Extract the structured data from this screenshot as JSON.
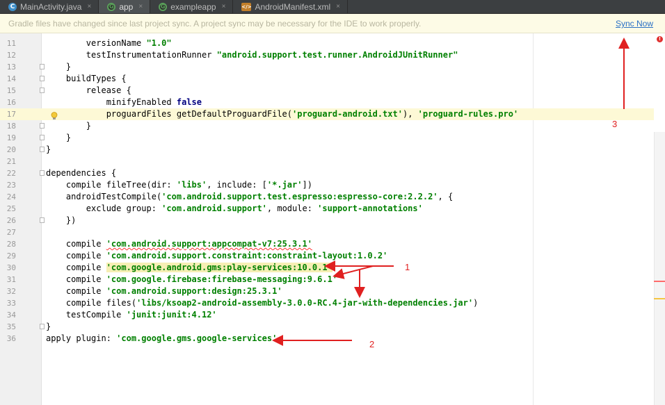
{
  "tabs": [
    {
      "label": "MainActivity.java",
      "icon": "c"
    },
    {
      "label": "app",
      "icon": "gradle"
    },
    {
      "label": "exampleapp",
      "icon": "gradle"
    },
    {
      "label": "AndroidManifest.xml",
      "icon": "xml"
    }
  ],
  "notification": {
    "message": "Gradle files have changed since last project sync. A project sync may be necessary for the IDE to work properly.",
    "action": "Sync Now"
  },
  "lines": [
    {
      "n": "11",
      "code": [
        {
          "t": "        versionName "
        },
        {
          "t": "\"1.0\"",
          "c": "str"
        }
      ]
    },
    {
      "n": "12",
      "code": [
        {
          "t": "        testInstrumentationRunner "
        },
        {
          "t": "\"android.support.test.runner.AndroidJUnitRunner\"",
          "c": "str"
        }
      ]
    },
    {
      "n": "13",
      "code": [
        {
          "t": "    }"
        }
      ]
    },
    {
      "n": "14",
      "code": [
        {
          "t": "    buildTypes {"
        }
      ]
    },
    {
      "n": "15",
      "code": [
        {
          "t": "        release {"
        }
      ]
    },
    {
      "n": "16",
      "code": [
        {
          "t": "            minifyEnabled "
        },
        {
          "t": "false",
          "c": "kw"
        }
      ]
    },
    {
      "n": "17",
      "code": [
        {
          "t": "            proguardFiles getDefaultProguardFile("
        },
        {
          "t": "'proguard-android.txt'",
          "c": "str"
        },
        {
          "t": "), "
        },
        {
          "t": "'proguard-rules.pro'",
          "c": "str"
        }
      ]
    },
    {
      "n": "18",
      "code": [
        {
          "t": "        }"
        }
      ]
    },
    {
      "n": "19",
      "code": [
        {
          "t": "    }"
        }
      ]
    },
    {
      "n": "20",
      "code": [
        {
          "t": "}"
        }
      ]
    },
    {
      "n": "21",
      "code": []
    },
    {
      "n": "22",
      "code": [
        {
          "t": "dependencies {"
        }
      ]
    },
    {
      "n": "23",
      "code": [
        {
          "t": "    compile fileTree(dir: "
        },
        {
          "t": "'libs'",
          "c": "str"
        },
        {
          "t": ", include: ["
        },
        {
          "t": "'*.jar'",
          "c": "str"
        },
        {
          "t": "])"
        }
      ]
    },
    {
      "n": "24",
      "code": [
        {
          "t": "    androidTestCompile("
        },
        {
          "t": "'com.android.support.test.espresso:espresso-core:2.2.2'",
          "c": "str"
        },
        {
          "t": ", {"
        }
      ]
    },
    {
      "n": "25",
      "code": [
        {
          "t": "        exclude group: "
        },
        {
          "t": "'com.android.support'",
          "c": "str"
        },
        {
          "t": ", module: "
        },
        {
          "t": "'support-annotations'",
          "c": "str"
        }
      ]
    },
    {
      "n": "26",
      "code": [
        {
          "t": "    })"
        }
      ]
    },
    {
      "n": "27",
      "code": []
    },
    {
      "n": "28",
      "code": [
        {
          "t": "    compile "
        },
        {
          "t": "'com.android.support:appcompat-v7:25.3.1'",
          "c": "str squig"
        }
      ]
    },
    {
      "n": "29",
      "code": [
        {
          "t": "    compile "
        },
        {
          "t": "'com.android.support.constraint:constraint-layout:1.0.2'",
          "c": "str"
        }
      ]
    },
    {
      "n": "30",
      "code": [
        {
          "t": "    compile "
        },
        {
          "t": "'com.google.android.gms:play-services:10.0.1'",
          "c": "str hlbg"
        }
      ]
    },
    {
      "n": "31",
      "code": [
        {
          "t": "    compile "
        },
        {
          "t": "'com.google.firebase:firebase-messaging:9.6.1'",
          "c": "str"
        }
      ]
    },
    {
      "n": "32",
      "code": [
        {
          "t": "    compile "
        },
        {
          "t": "'com.android.support:design:25.3.1'",
          "c": "str"
        }
      ]
    },
    {
      "n": "33",
      "code": [
        {
          "t": "    compile files("
        },
        {
          "t": "'libs/ksoap2-android-assembly-3.0.0-RC.4-jar-with-dependencies.jar'",
          "c": "str"
        },
        {
          "t": ")"
        }
      ]
    },
    {
      "n": "34",
      "code": [
        {
          "t": "    testCompile "
        },
        {
          "t": "'junit:junit:4.12'",
          "c": "str"
        }
      ]
    },
    {
      "n": "35",
      "code": [
        {
          "t": "}"
        }
      ]
    },
    {
      "n": "36",
      "code": [
        {
          "t": "apply plugin: "
        },
        {
          "t": "'com.google.gms.google-services'",
          "c": "str"
        }
      ]
    }
  ],
  "highlighted_line": "17",
  "folds": [
    "13",
    "14",
    "15",
    "18",
    "19",
    "20",
    "22",
    "26",
    "35"
  ],
  "annotations": [
    "1",
    "2",
    "3"
  ],
  "colors": {
    "annotation": "#e02020",
    "string": "#008000",
    "keyword": "#000080",
    "sync_link": "#2970c5"
  }
}
